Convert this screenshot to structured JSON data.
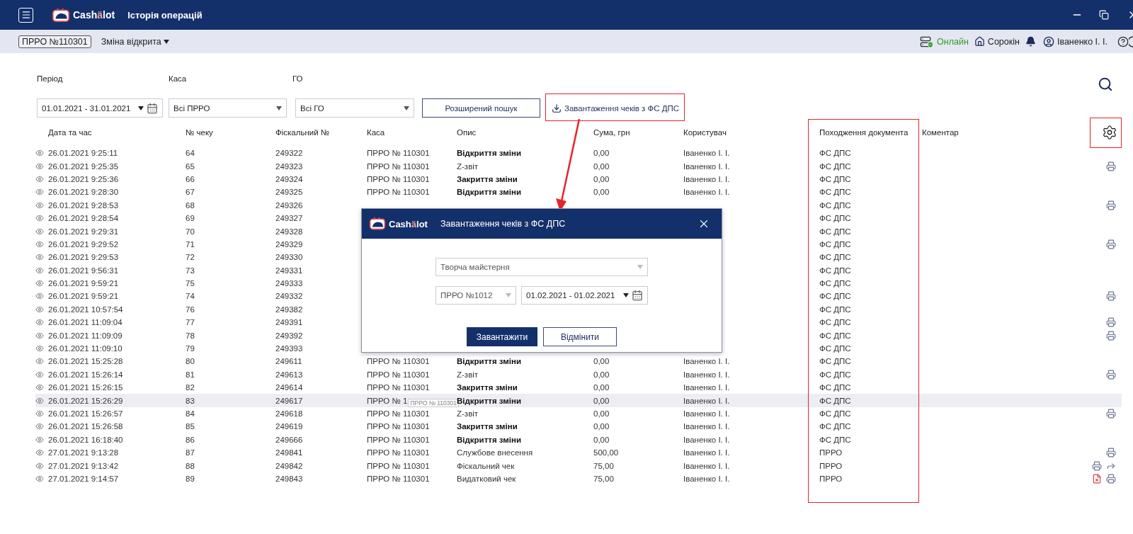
{
  "app": {
    "logo_head": "Cash",
    "logo_accent": "ä",
    "logo_tail": "lot",
    "title": "Історія операцій"
  },
  "status_bar": {
    "register": "ПРРО №110301",
    "shift": "Зміна відкрита",
    "connection": "Онлайн",
    "online": true,
    "shop": "Сорокін",
    "user": "Іваненко І. І."
  },
  "filters": {
    "period_label": "Період",
    "register_label": "Каса",
    "org_label": "ГО",
    "period": "01.01.2021 - 31.01.2021",
    "register": "Всі ПРРО",
    "org": "Всі ГО",
    "advanced_button": "Розширений пошук",
    "download_link": "Завантаження чеків з ФС ДПС"
  },
  "table": {
    "columns": [
      "Дата та час",
      "№ чеку",
      "Фіскальний №",
      "Каса",
      "Опис",
      "Сума, грн",
      "Користувач",
      "Походження документа",
      "Коментар"
    ],
    "rows": [
      {
        "time": "26.01.2021 9:25:11",
        "number": "64",
        "fiscal": "249322",
        "kasa": "ПРРО № 110301",
        "description": "Відкриття зміни",
        "bold": true,
        "amount": "0,00",
        "user": "Іваненко І. І.",
        "origin": "ФС ДПС",
        "selected": false,
        "actions": []
      },
      {
        "time": "26.01.2021 9:25:35",
        "number": "65",
        "fiscal": "249323",
        "kasa": "ПРРО № 110301",
        "description": "Z-звіт",
        "bold": false,
        "amount": "0,00",
        "user": "Іваненко І. І.",
        "origin": "ФС ДПС",
        "selected": false,
        "actions": [
          {
            "kind": "print"
          }
        ]
      },
      {
        "time": "26.01.2021 9:25:36",
        "number": "66",
        "fiscal": "249324",
        "kasa": "ПРРО № 110301",
        "description": "Закриття зміни",
        "bold": true,
        "amount": "0,00",
        "user": "Іваненко І. І.",
        "origin": "ФС ДПС",
        "selected": false,
        "actions": []
      },
      {
        "time": "26.01.2021 9:28:30",
        "number": "67",
        "fiscal": "249325",
        "kasa": "ПРРО № 110301",
        "description": "Відкриття зміни",
        "bold": true,
        "amount": "0,00",
        "user": "Іваненко І. І.",
        "origin": "ФС ДПС",
        "selected": false,
        "actions": []
      },
      {
        "time": "26.01.2021 9:28:53",
        "number": "68",
        "fiscal": "249326",
        "origin": "ФС ДПС",
        "selected": false,
        "actions": [
          {
            "kind": "print"
          }
        ]
      },
      {
        "time": "26.01.2021 9:28:54",
        "number": "69",
        "fiscal": "249327",
        "origin": "ФС ДПС",
        "selected": false,
        "actions": []
      },
      {
        "time": "26.01.2021 9:29:31",
        "number": "70",
        "fiscal": "249328",
        "origin": "ФС ДПС",
        "selected": false,
        "actions": []
      },
      {
        "time": "26.01.2021 9:29:52",
        "number": "71",
        "fiscal": "249329",
        "origin": "ФС ДПС",
        "selected": false,
        "actions": [
          {
            "kind": "print"
          }
        ]
      },
      {
        "time": "26.01.2021 9:29:53",
        "number": "72",
        "fiscal": "249330",
        "origin": "ФС ДПС",
        "selected": false,
        "actions": []
      },
      {
        "time": "26.01.2021 9:56:31",
        "number": "73",
        "fiscal": "249331",
        "origin": "ФС ДПС",
        "selected": false,
        "actions": []
      },
      {
        "time": "26.01.2021 9:59:21",
        "number": "75",
        "fiscal": "249333",
        "origin": "ФС ДПС",
        "selected": false,
        "actions": []
      },
      {
        "time": "26.01.2021 9:59:21",
        "number": "74",
        "fiscal": "249332",
        "origin": "ФС ДПС",
        "selected": false,
        "actions": [
          {
            "kind": "print"
          }
        ]
      },
      {
        "time": "26.01.2021 10:57:54",
        "number": "76",
        "fiscal": "249382",
        "origin": "ФС ДПС",
        "selected": false,
        "actions": []
      },
      {
        "time": "26.01.2021 11:09:04",
        "number": "77",
        "fiscal": "249391",
        "origin": "ФС ДПС",
        "selected": false,
        "actions": [
          {
            "kind": "print"
          }
        ]
      },
      {
        "time": "26.01.2021 11:09:09",
        "number": "78",
        "fiscal": "249392",
        "origin": "ФС ДПС",
        "selected": false,
        "actions": [
          {
            "kind": "print"
          }
        ]
      },
      {
        "time": "26.01.2021 11:09:10",
        "number": "79",
        "fiscal": "249393",
        "origin": "ФС ДПС",
        "selected": false,
        "actions": []
      },
      {
        "time": "26.01.2021 15:25:28",
        "number": "80",
        "fiscal": "249611",
        "kasa": "ПРРО № 110301",
        "description": "Відкриття зміни",
        "bold": true,
        "amount": "0,00",
        "user": "Іваненко І. І.",
        "origin": "ФС ДПС",
        "selected": false,
        "actions": []
      },
      {
        "time": "26.01.2021 15:26:14",
        "number": "81",
        "fiscal": "249613",
        "kasa": "ПРРО № 110301",
        "description": "Z-звіт",
        "bold": false,
        "amount": "0,00",
        "user": "Іваненко І. І.",
        "origin": "ФС ДПС",
        "selected": false,
        "actions": [
          {
            "kind": "print"
          }
        ]
      },
      {
        "time": "26.01.2021 15:26:15",
        "number": "82",
        "fiscal": "249614",
        "kasa": "ПРРО № 110301",
        "description": "Закриття зміни",
        "bold": true,
        "amount": "0,00",
        "user": "Іваненко І. І.",
        "origin": "ФС ДПС",
        "selected": false,
        "actions": []
      },
      {
        "time": "26.01.2021 15:26:29",
        "number": "83",
        "fiscal": "249617",
        "kasa": "ПРРО № 1",
        "tooltip": "ПРРО № 110301",
        "description": "Відкриття зміни",
        "bold": true,
        "amount": "0,00",
        "user": "Іваненко І. І.",
        "origin": "ФС ДПС",
        "selected": true,
        "actions": []
      },
      {
        "time": "26.01.2021 15:26:57",
        "number": "84",
        "fiscal": "249618",
        "kasa": "ПРРО № 110301",
        "description": "Z-звіт",
        "bold": false,
        "amount": "0,00",
        "user": "Іваненко І. І.",
        "origin": "ФС ДПС",
        "selected": false,
        "actions": [
          {
            "kind": "print"
          }
        ]
      },
      {
        "time": "26.01.2021 15:26:58",
        "number": "85",
        "fiscal": "249619",
        "kasa": "ПРРО № 110301",
        "description": "Закриття зміни",
        "bold": true,
        "amount": "0,00",
        "user": "Іваненко І. І.",
        "origin": "ФС ДПС",
        "selected": false,
        "actions": []
      },
      {
        "time": "26.01.2021 16:18:40",
        "number": "86",
        "fiscal": "249666",
        "kasa": "ПРРО № 110301",
        "description": "Відкриття зміни",
        "bold": true,
        "amount": "0,00",
        "user": "Іваненко І. І.",
        "origin": "ФС ДПС",
        "selected": false,
        "actions": []
      },
      {
        "time": "27.01.2021 9:13:28",
        "number": "87",
        "fiscal": "249841",
        "kasa": "ПРРО № 110301",
        "description": "Службове внесення",
        "bold": false,
        "amount": "500,00",
        "user": "Іваненко І. І.",
        "origin": "ПРРО",
        "selected": false,
        "actions": [
          {
            "kind": "print"
          }
        ]
      },
      {
        "time": "27.01.2021 9:13:42",
        "number": "88",
        "fiscal": "249842",
        "kasa": "ПРРО № 110301",
        "description": "Фіскальний чек",
        "bold": false,
        "amount": "75,00",
        "user": "Іваненко І. І.",
        "origin": "ПРРО",
        "selected": false,
        "actions": [
          {
            "kind": "print"
          },
          {
            "kind": "share"
          }
        ]
      },
      {
        "time": "27.01.2021 9:14:57",
        "number": "89",
        "fiscal": "249843",
        "kasa": "ПРРО № 110301",
        "description": "Видатковий чек",
        "bold": false,
        "amount": "75,00",
        "user": "Іваненко І. І.",
        "origin": "ПРРО",
        "selected": false,
        "actions": [
          {
            "kind": "cancel"
          },
          {
            "kind": "print"
          }
        ]
      }
    ]
  },
  "dialog": {
    "logo_head": "Cash",
    "logo_accent": "ä",
    "logo_tail": "lot",
    "title": "Завантаження чеків з ФС ДПС",
    "organization": "Творча майстерня",
    "register": "ПРРО №1012",
    "period": "01.02.2021 - 01.02.2021",
    "confirm_button": "Завантажити",
    "cancel_button": "Відмінити"
  }
}
